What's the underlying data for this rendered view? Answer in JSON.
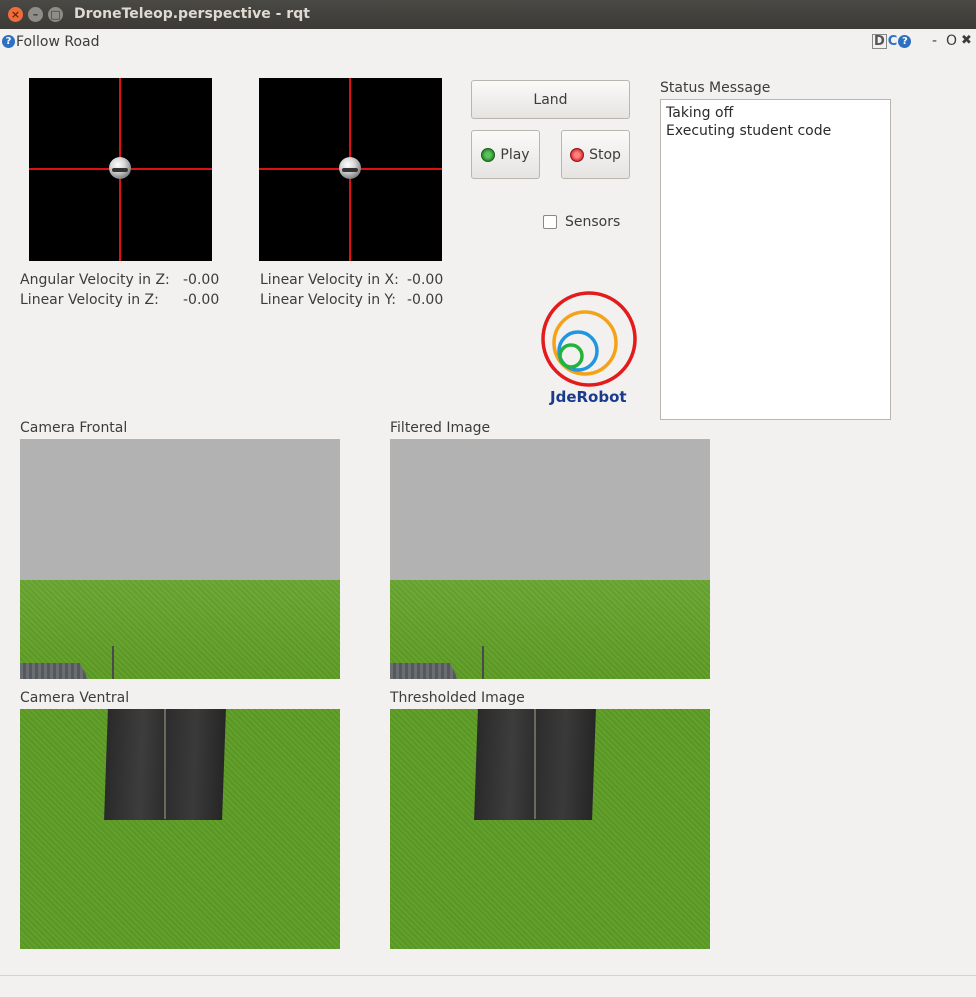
{
  "window": {
    "title": "DroneTeleop.perspective - rqt"
  },
  "plugin": {
    "title": "Follow Road",
    "help_glyph": "?",
    "right_icons": [
      "D",
      "C",
      "?"
    ],
    "minimize": "-",
    "restore": "O",
    "close": "✖"
  },
  "velocities": {
    "angular_z_label": "Angular Velocity in Z:",
    "angular_z_value": "-0.00",
    "linear_z_label": "Linear Velocity in Z:",
    "linear_z_value": "-0.00",
    "linear_x_label": "Linear Velocity in X:",
    "linear_x_value": "-0.00",
    "linear_y_label": "Linear Velocity in Y:",
    "linear_y_value": "-0.00"
  },
  "controls": {
    "land": "Land",
    "play": "Play",
    "stop": "Stop",
    "sensors": "Sensors"
  },
  "status": {
    "label": "Status Message",
    "lines": [
      "Taking off",
      "Executing student code"
    ]
  },
  "logo": {
    "text": "JdeRobot"
  },
  "images": {
    "camera_frontal": "Camera Frontal",
    "filtered": "Filtered Image",
    "camera_ventral": "Camera Ventral",
    "thresholded": "Thresholded Image"
  },
  "colors": {
    "crosshair": "#e01010",
    "play_dot": "#2a8a2a",
    "stop_dot": "#d83030",
    "logo_text": "#1a3a8c"
  }
}
